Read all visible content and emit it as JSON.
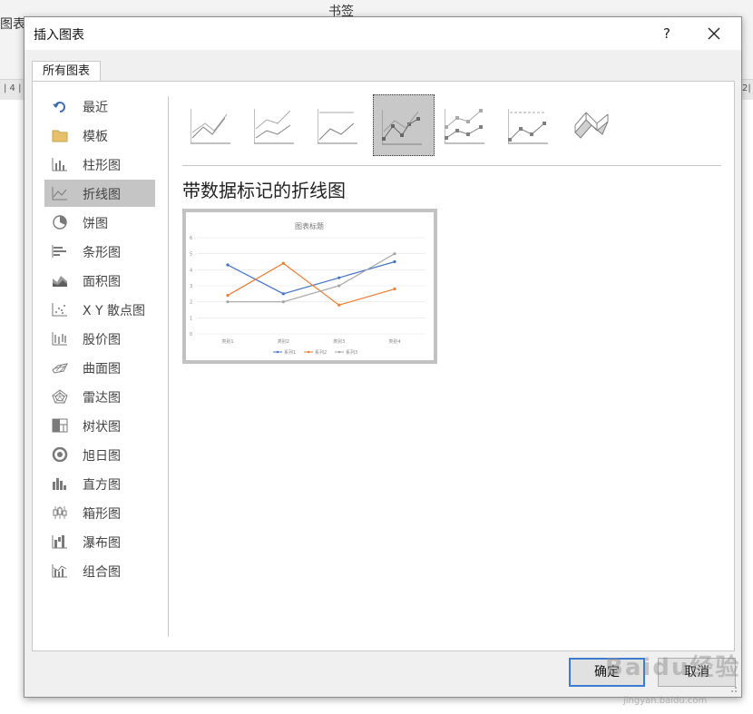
{
  "ribbon": {
    "frag_left": "图表",
    "bookmark": "书签",
    "strip_left": "| 4 |",
    "strip_right": "2|"
  },
  "dialog": {
    "title": "插入图表",
    "help": "?",
    "tab": "所有图表",
    "chart_types": [
      {
        "label": "最近",
        "icon": "undo-arrow-icon"
      },
      {
        "label": "模板",
        "icon": "folder-icon"
      },
      {
        "label": "柱形图",
        "icon": "column-chart-icon"
      },
      {
        "label": "折线图",
        "icon": "line-chart-icon",
        "selected": true
      },
      {
        "label": "饼图",
        "icon": "pie-chart-icon"
      },
      {
        "label": "条形图",
        "icon": "bar-chart-icon"
      },
      {
        "label": "面积图",
        "icon": "area-chart-icon"
      },
      {
        "label": "X Y 散点图",
        "icon": "scatter-chart-icon"
      },
      {
        "label": "股价图",
        "icon": "stock-chart-icon"
      },
      {
        "label": "曲面图",
        "icon": "surface-chart-icon"
      },
      {
        "label": "雷达图",
        "icon": "radar-chart-icon"
      },
      {
        "label": "树状图",
        "icon": "treemap-chart-icon"
      },
      {
        "label": "旭日图",
        "icon": "sunburst-chart-icon"
      },
      {
        "label": "直方图",
        "icon": "histogram-chart-icon"
      },
      {
        "label": "箱形图",
        "icon": "box-whisker-chart-icon"
      },
      {
        "label": "瀑布图",
        "icon": "waterfall-chart-icon"
      },
      {
        "label": "组合图",
        "icon": "combo-chart-icon"
      }
    ],
    "subtypes": [
      {
        "icon": "line-subtype-icon"
      },
      {
        "icon": "stacked-line-subtype-icon"
      },
      {
        "icon": "percent-stacked-line-subtype-icon"
      },
      {
        "icon": "line-with-markers-subtype-icon",
        "selected": true
      },
      {
        "icon": "stacked-line-with-markers-subtype-icon"
      },
      {
        "icon": "percent-stacked-line-with-markers-subtype-icon"
      },
      {
        "icon": "3d-line-subtype-icon"
      }
    ],
    "selected_heading": "带数据标记的折线图",
    "ok_label": "确定",
    "cancel_label": "取消",
    "watermark": "Baidu经验",
    "watermark_sub": "jingyan.baidu.com"
  },
  "chart_data": {
    "type": "line",
    "title": "图表标题",
    "categories": [
      "类别1",
      "类别2",
      "类别3",
      "类别4"
    ],
    "series": [
      {
        "name": "系列1",
        "values": [
          4.3,
          2.5,
          3.5,
          4.5
        ],
        "color": "#4472c4"
      },
      {
        "name": "系列2",
        "values": [
          2.4,
          4.4,
          1.8,
          2.8
        ],
        "color": "#ed7d31"
      },
      {
        "name": "系列3",
        "values": [
          2,
          2,
          3,
          5
        ],
        "color": "#a5a5a5"
      }
    ],
    "ylim": [
      0,
      6
    ],
    "yticks": [
      "0",
      "1",
      "2",
      "3",
      "4",
      "5",
      "6"
    ],
    "grid": true,
    "legend": "bottom"
  }
}
